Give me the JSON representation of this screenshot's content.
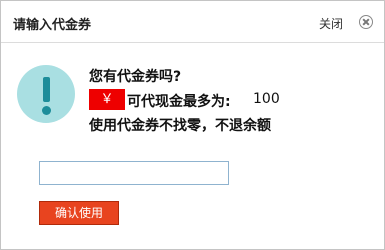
{
  "dialog": {
    "title": "请输入代金券",
    "close_label": "关闭"
  },
  "message": {
    "question": "您有代金券吗?",
    "currency_symbol": "￥",
    "max_label": "可代现金最多为:",
    "max_amount": "100",
    "note": "使用代金券不找零，不退余额"
  },
  "form": {
    "code_value": "",
    "confirm_label": "确认使用"
  },
  "colors": {
    "badge": "#ee0000",
    "button": "#e8441f",
    "icon_bg": "#a9dfe2",
    "icon_fg": "#1d8d9a"
  },
  "icons": {
    "info": "exclamation-icon",
    "close": "close-icon"
  }
}
